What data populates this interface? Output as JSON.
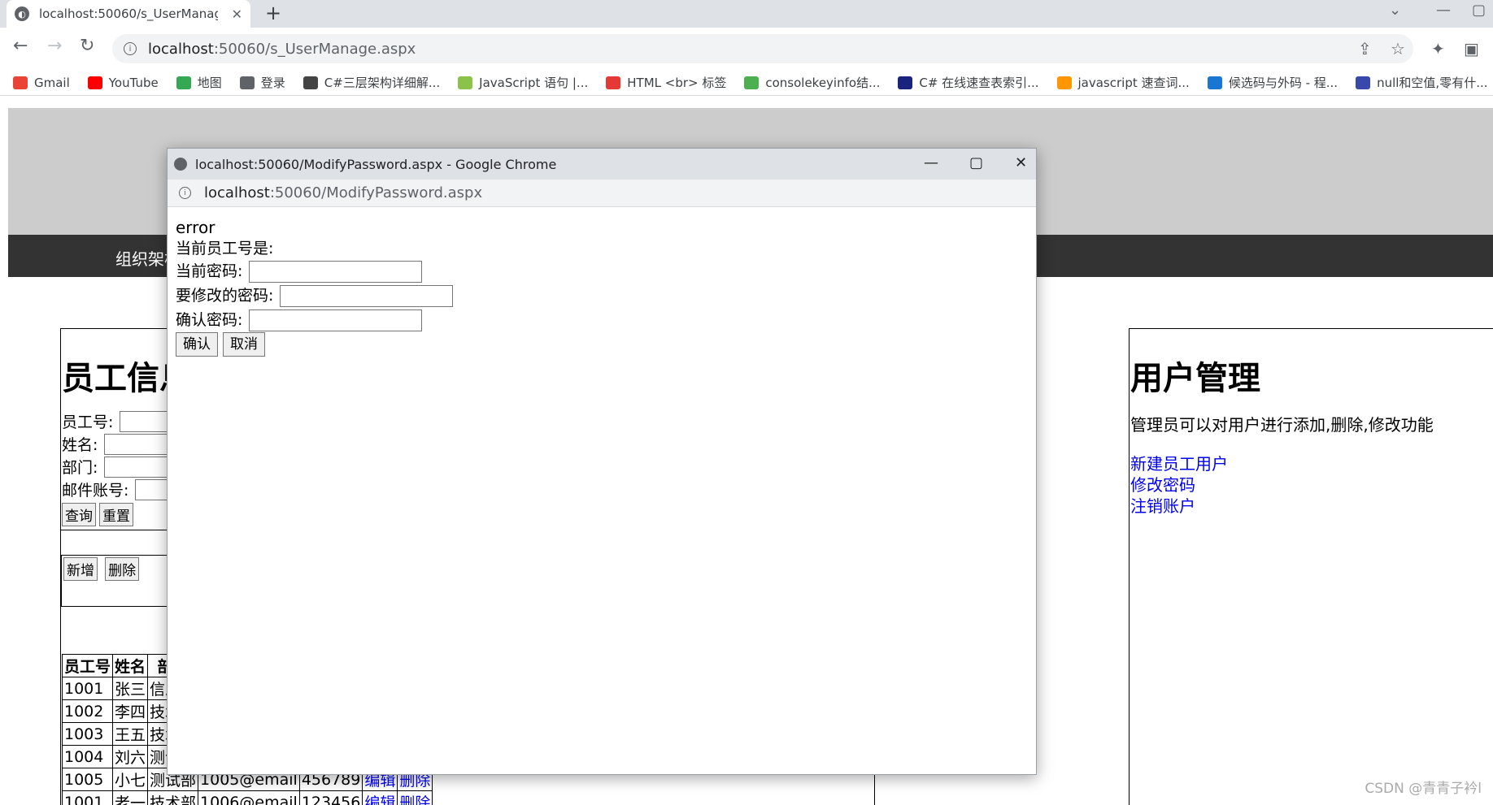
{
  "browser": {
    "tab_title": "localhost:50060/s_UserManage.aspx",
    "url_host": "localhost",
    "url_path": ":50060/s_UserManage.aspx"
  },
  "bookmarks": [
    {
      "label": "Gmail",
      "color": "#ea4335"
    },
    {
      "label": "YouTube",
      "color": "#ff0000"
    },
    {
      "label": "地图",
      "color": "#34a853"
    },
    {
      "label": "登录",
      "color": "#5f6368"
    },
    {
      "label": "C#三层架构详细解...",
      "color": "#444"
    },
    {
      "label": "JavaScript 语句 |...",
      "color": "#8bc34a"
    },
    {
      "label": "HTML <br> 标签",
      "color": "#e53935"
    },
    {
      "label": "consolekeyinfo结...",
      "color": "#4caf50"
    },
    {
      "label": "C# 在线速查表索引...",
      "color": "#1a237e"
    },
    {
      "label": "javascript 速查词...",
      "color": "#ff9800"
    },
    {
      "label": "候选码与外码 - 程...",
      "color": "#1976d2"
    },
    {
      "label": "null和空值,零有什...",
      "color": "#3949ab"
    }
  ],
  "page": {
    "nav_item": "组织架构",
    "left_title": "员工信息",
    "form": {
      "emp_no_label": "员工号:",
      "name_label": "姓名:",
      "dept_label": "部门:",
      "email_label": "邮件账号:",
      "query_btn": "查询",
      "reset_btn": "重置"
    },
    "add_btn": "新增",
    "delete_btn": "删除",
    "table": {
      "headers": [
        "员工号",
        "姓名",
        "部门"
      ],
      "rows": [
        [
          "1001",
          "张三",
          "信息"
        ],
        [
          "1002",
          "李四",
          "技术"
        ],
        [
          "1003",
          "王五",
          "技术"
        ],
        [
          "1004",
          "刘六",
          "测试"
        ],
        [
          "1005",
          "小七",
          "测试部",
          "1005@email",
          "456789",
          "编辑",
          "删除"
        ],
        [
          "1001",
          "老一",
          "技术部",
          "1006@email",
          "123456",
          "编辑",
          "删除"
        ]
      ]
    },
    "right_title": "用户管理",
    "right_desc": "管理员可以对用户进行添加,删除,修改功能",
    "right_links": [
      "新建员工用户",
      "修改密码",
      "注销账户"
    ],
    "watermark": "CSDN @青青子衿l"
  },
  "popup": {
    "title": "localhost:50060/ModifyPassword.aspx - Google Chrome",
    "url_host": "localhost",
    "url_path": ":50060/ModifyPassword.aspx",
    "error_text": "error",
    "current_emp_label": "当前员工号是:",
    "current_pwd_label": "当前密码:",
    "new_pwd_label": "要修改的密码:",
    "confirm_pwd_label": "确认密码:",
    "confirm_btn": "确认",
    "cancel_btn": "取消"
  }
}
